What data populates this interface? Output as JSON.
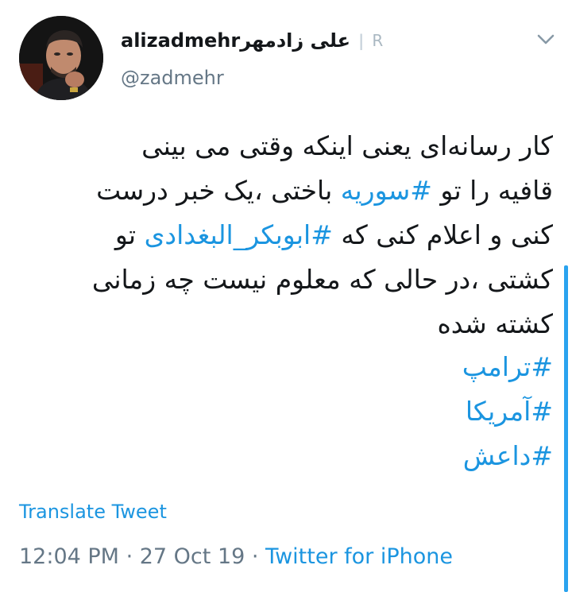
{
  "profile": {
    "display_name": "alizadmehrعلی زادمهر",
    "badge_text": "R",
    "handle": "@zadmehr"
  },
  "tweet": {
    "line1": "کار رسانه‌ای یعنی اینکه وقتی می بینی",
    "line2_prefix": "قافیه را تو ",
    "line2_hashtag": "#سوریه",
    "line2_suffix": " باختی ،یک خبر درست",
    "line3_prefix": "کنی و اعلام کنی که ",
    "line3_hashtag": "#ابوبکر_البغدادی",
    "line3_suffix": " تو",
    "line4": "کشتی ،در حالی که معلوم نیست چه زمانی",
    "line5": "کشته شده",
    "hashtags": [
      "#ترامپ",
      "#آمریکا",
      "#داعش"
    ]
  },
  "actions": {
    "translate_label": "Translate Tweet"
  },
  "meta": {
    "time": "12:04 PM",
    "separator": " · ",
    "date": "27 Oct 19",
    "source": "Twitter for iPhone"
  },
  "icons": {
    "menu": "chevron-down-icon"
  },
  "colors": {
    "link": "#1b95e0",
    "secondary_text": "#657786",
    "primary_text": "#14171a"
  }
}
